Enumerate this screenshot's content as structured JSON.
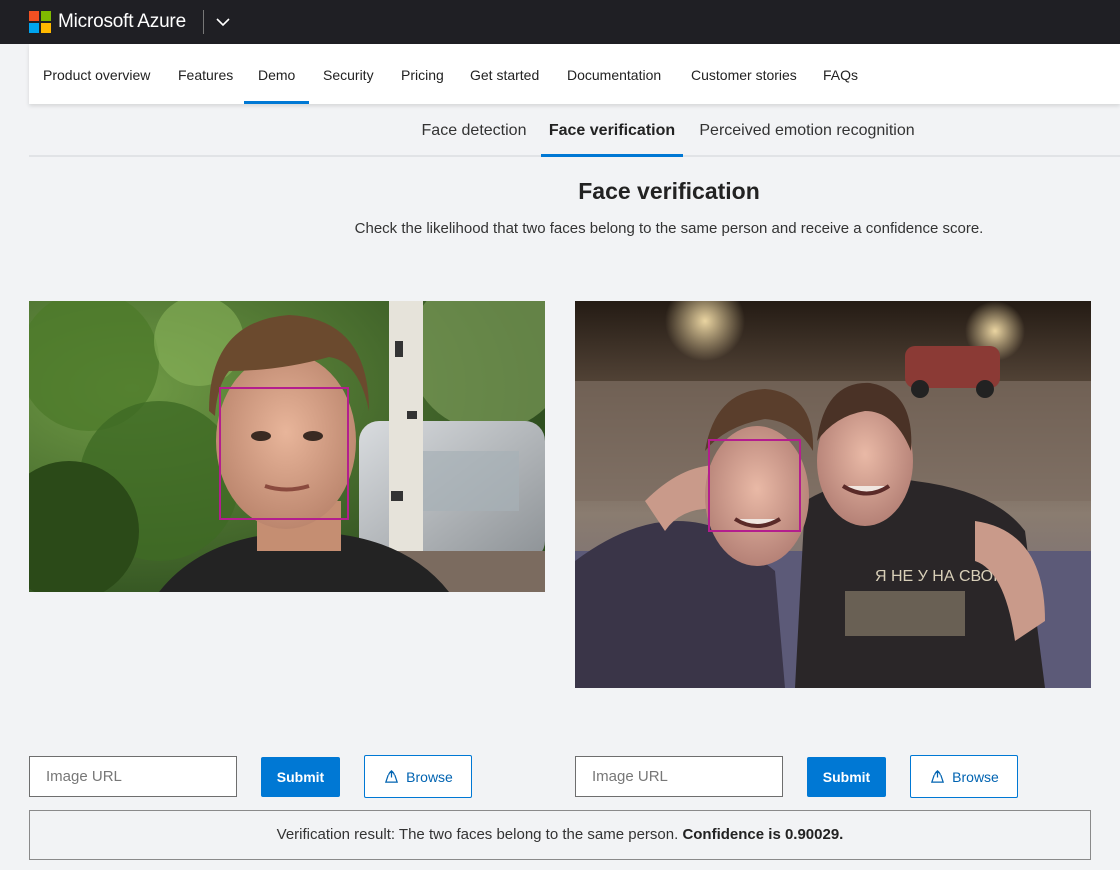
{
  "header": {
    "brand": "Microsoft Azure",
    "logo_colors": [
      "#f25022",
      "#7fba00",
      "#00a4ef",
      "#ffb900"
    ]
  },
  "nav": {
    "items": [
      {
        "label": "Product overview",
        "active": false
      },
      {
        "label": "Features",
        "active": false
      },
      {
        "label": "Demo",
        "active": true
      },
      {
        "label": "Security",
        "active": false
      },
      {
        "label": "Pricing",
        "active": false
      },
      {
        "label": "Get started",
        "active": false
      },
      {
        "label": "Documentation",
        "active": false
      },
      {
        "label": "Customer stories",
        "active": false
      },
      {
        "label": "FAQs",
        "active": false
      }
    ]
  },
  "subtabs": [
    {
      "label": "Face detection",
      "active": false
    },
    {
      "label": "Face verification",
      "active": true
    },
    {
      "label": "Perceived emotion recognition",
      "active": false
    }
  ],
  "main": {
    "title": "Face verification",
    "description": "Check the likelihood that two faces belong to the same person and receive a confidence score."
  },
  "left_panel": {
    "url_placeholder": "Image URL",
    "submit_label": "Submit",
    "browse_label": "Browse"
  },
  "right_panel": {
    "url_placeholder": "Image URL",
    "submit_label": "Submit",
    "browse_label": "Browse"
  },
  "result": {
    "prefix": "Verification result: The two faces belong to the same person.",
    "confidence": "Confidence is 0.90029."
  },
  "colors": {
    "accent": "#0078d4",
    "face_box": "#b41e8e",
    "topbar": "#1f1f24"
  }
}
